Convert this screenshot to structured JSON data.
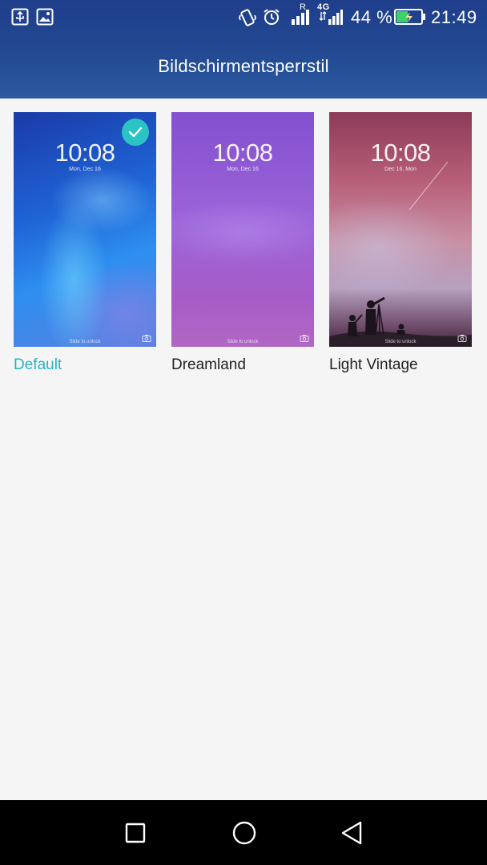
{
  "status_bar": {
    "battery_percent": "44 %",
    "time": "21:49",
    "icons": [
      "usb-icon",
      "image-icon",
      "vibrate-icon",
      "alarm-icon",
      "signal-roaming-icon",
      "signal-4g-icon",
      "battery-charging-icon"
    ],
    "network_roaming": "R",
    "network_type": "4G"
  },
  "header": {
    "title": "Bildschirmentsperrstil"
  },
  "styles": [
    {
      "label": "Default",
      "selected": true,
      "preview_time": "10:08",
      "preview_date": "Mon, Dec 16",
      "preview_hint": "Slide to unlock"
    },
    {
      "label": "Dreamland",
      "selected": false,
      "preview_time": "10:08",
      "preview_date": "Mon, Dec 16",
      "preview_hint": "Slide to unlock"
    },
    {
      "label": "Light Vintage",
      "selected": false,
      "preview_time": "10:08",
      "preview_date": "Dec 16, Mon",
      "preview_hint": "Slide to unlock"
    }
  ],
  "colors": {
    "accent": "#26b4c6",
    "header_bg": "#234a92",
    "content_bg": "#f5f5f5",
    "nav_bg": "#000000"
  },
  "nav_bar": {
    "icons": [
      "recents-icon",
      "home-icon",
      "back-icon"
    ]
  }
}
